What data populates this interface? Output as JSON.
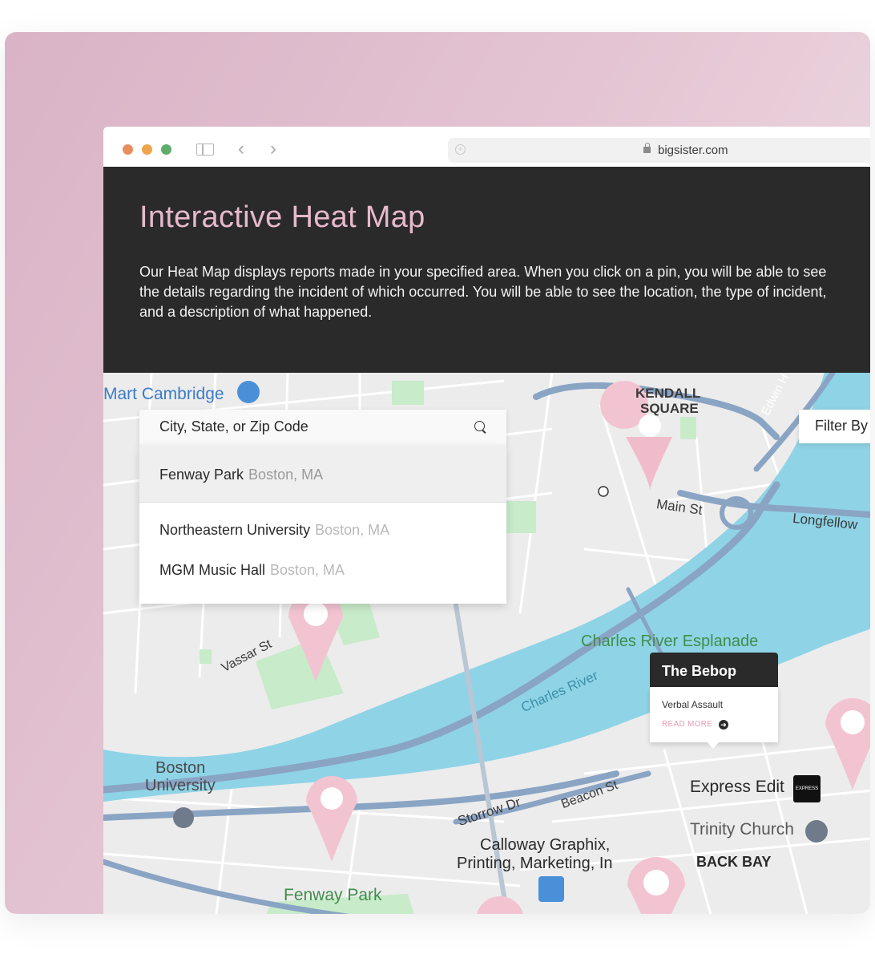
{
  "browser": {
    "url": "bigsister.com",
    "colors": {
      "close": "#e88e5e",
      "minimize": "#f0a54a",
      "maximize": "#5fad6b"
    }
  },
  "hero": {
    "title": "Interactive Heat Map",
    "description": "Our Heat Map displays reports made in your specified area. When you click on a pin, you will be able to see the details regarding the incident of which occurred. You will be able to see the location, the type of incident, and a description of what happened."
  },
  "search": {
    "placeholder": "City, State, or Zip Code",
    "suggestions": [
      {
        "name": "Fenway Park",
        "location": "Boston, MA"
      },
      {
        "name": "Northeastern University",
        "location": "Boston, MA"
      },
      {
        "name": "MGM Music Hall",
        "location": "Boston, MA"
      }
    ]
  },
  "filter": {
    "label": "Filter By"
  },
  "popup": {
    "title": "The Bebop",
    "type": "Verbal Assault",
    "read_more": "READ MORE"
  },
  "map": {
    "labels": {
      "mart_cambridge": "Mart Cambridge",
      "kendall": "KENDALL",
      "square": "SQUARE",
      "edwin": "Edwin H Lan",
      "main_st": "Main St",
      "longfellow": "Longfellow",
      "vassar": "Vassar St",
      "esplanade": "Charles River Esplanade",
      "charles_river": "Charles River",
      "boston": "Boston",
      "university": "University",
      "express_edit": "Express Edit",
      "express_badge": "EXPRESS",
      "trinity": "Trinity Church",
      "storrow": "Storrow Dr",
      "beacon": "Beacon St",
      "calloway1": "Calloway Graphix,",
      "calloway2": "Printing, Marketing, In",
      "back_bay": "BACK BAY",
      "fenway": "Fenway Park"
    },
    "colors": {
      "water": "#8fd3e6",
      "park": "#c8ebc9",
      "highway": "#8aa4c4",
      "pin": "#f2c4d2"
    }
  }
}
